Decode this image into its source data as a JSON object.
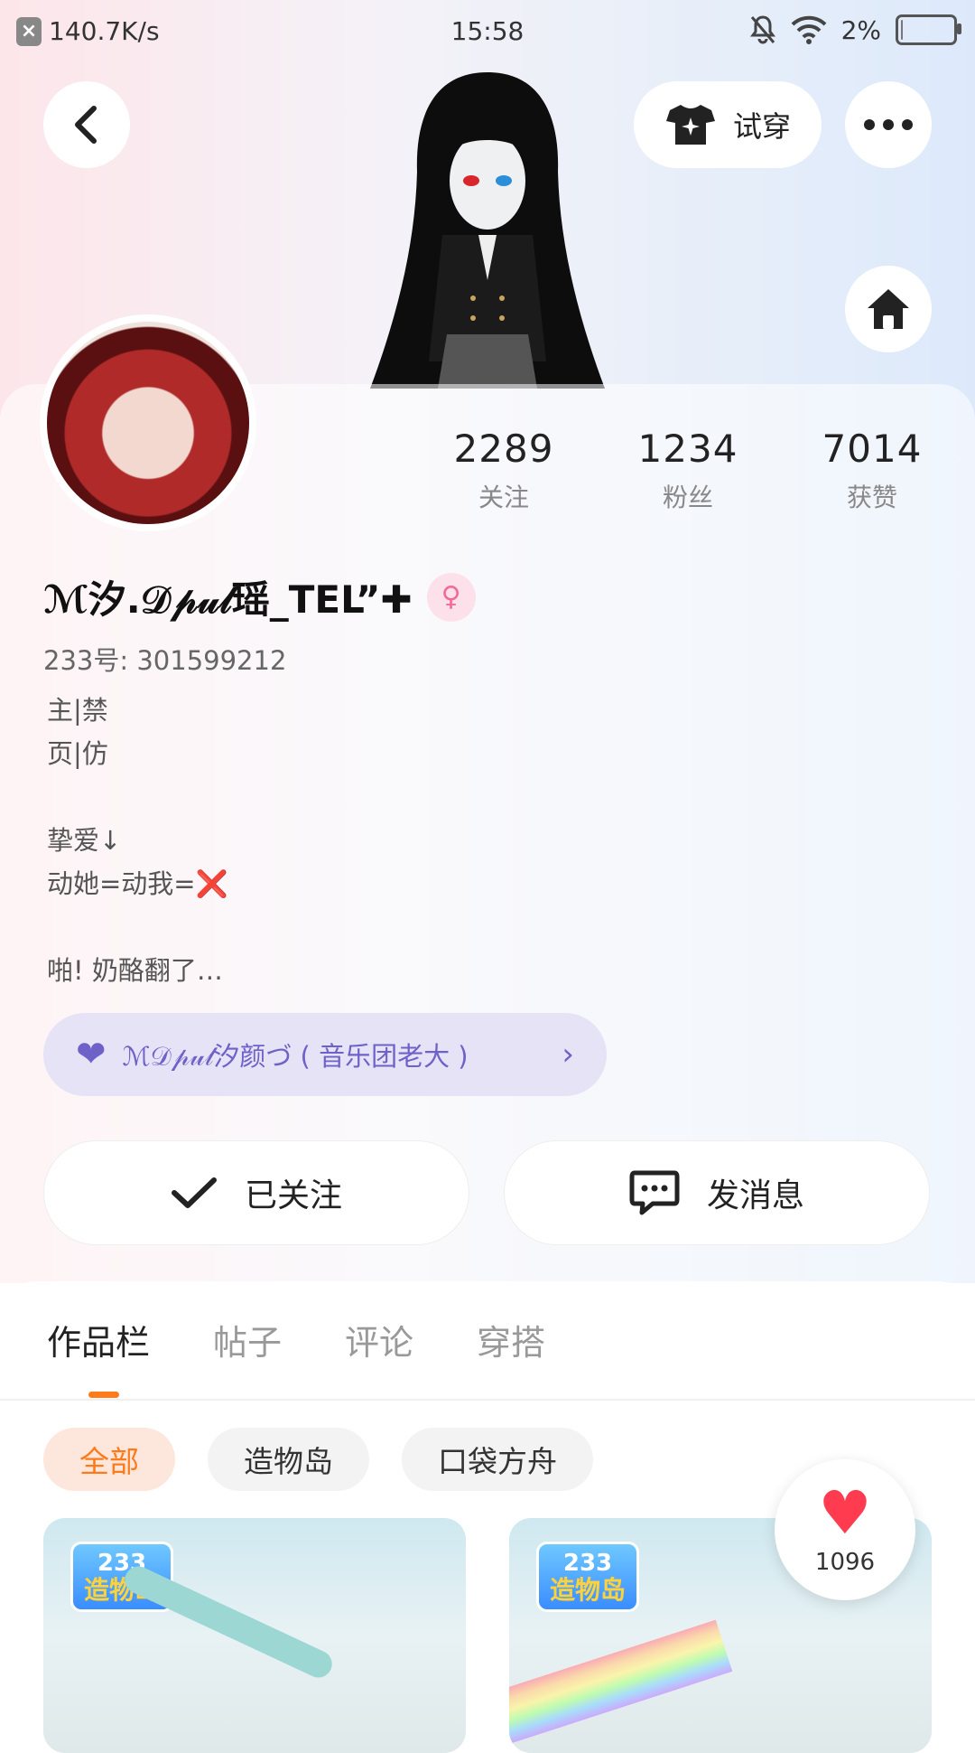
{
  "status_bar": {
    "net_speed": "140.7K/s",
    "time": "15:58",
    "battery": "2%",
    "battery_level": 0.02
  },
  "header": {
    "try_on_label": "试穿"
  },
  "profile": {
    "nickname": "ℳ汐.𝒟𝓅𝓊𝓁瑶_TEL”✚",
    "gender_symbol": "♀",
    "uid_line": "233号: 301599212",
    "bio": "主|禁\n页|仿\n\n挚爱↓\n动她=动我=❌\n\n啪! 奶酪翻了…",
    "relation": "ℳ𝒟𝓅𝓊𝓁汐颜づ ( 音乐团老大 )"
  },
  "stats": [
    {
      "value": "2289",
      "label": "关注"
    },
    {
      "value": "1234",
      "label": "粉丝"
    },
    {
      "value": "7014",
      "label": "获赞"
    }
  ],
  "actions": {
    "follow_label": "已关注",
    "message_label": "发消息"
  },
  "tabs": [
    "作品栏",
    "帖子",
    "评论",
    "穿搭"
  ],
  "filters": [
    "全部",
    "造物岛",
    "口袋方舟"
  ],
  "thumbnails": [
    {
      "logo_top": "233",
      "logo_bottom": "造物岛"
    },
    {
      "logo_top": "233",
      "logo_bottom": "造物岛"
    }
  ],
  "like_count": "1096",
  "colors": {
    "accent": "#ff7a1a",
    "relation": "#6e62c9",
    "heart": "#ff3b4f"
  }
}
